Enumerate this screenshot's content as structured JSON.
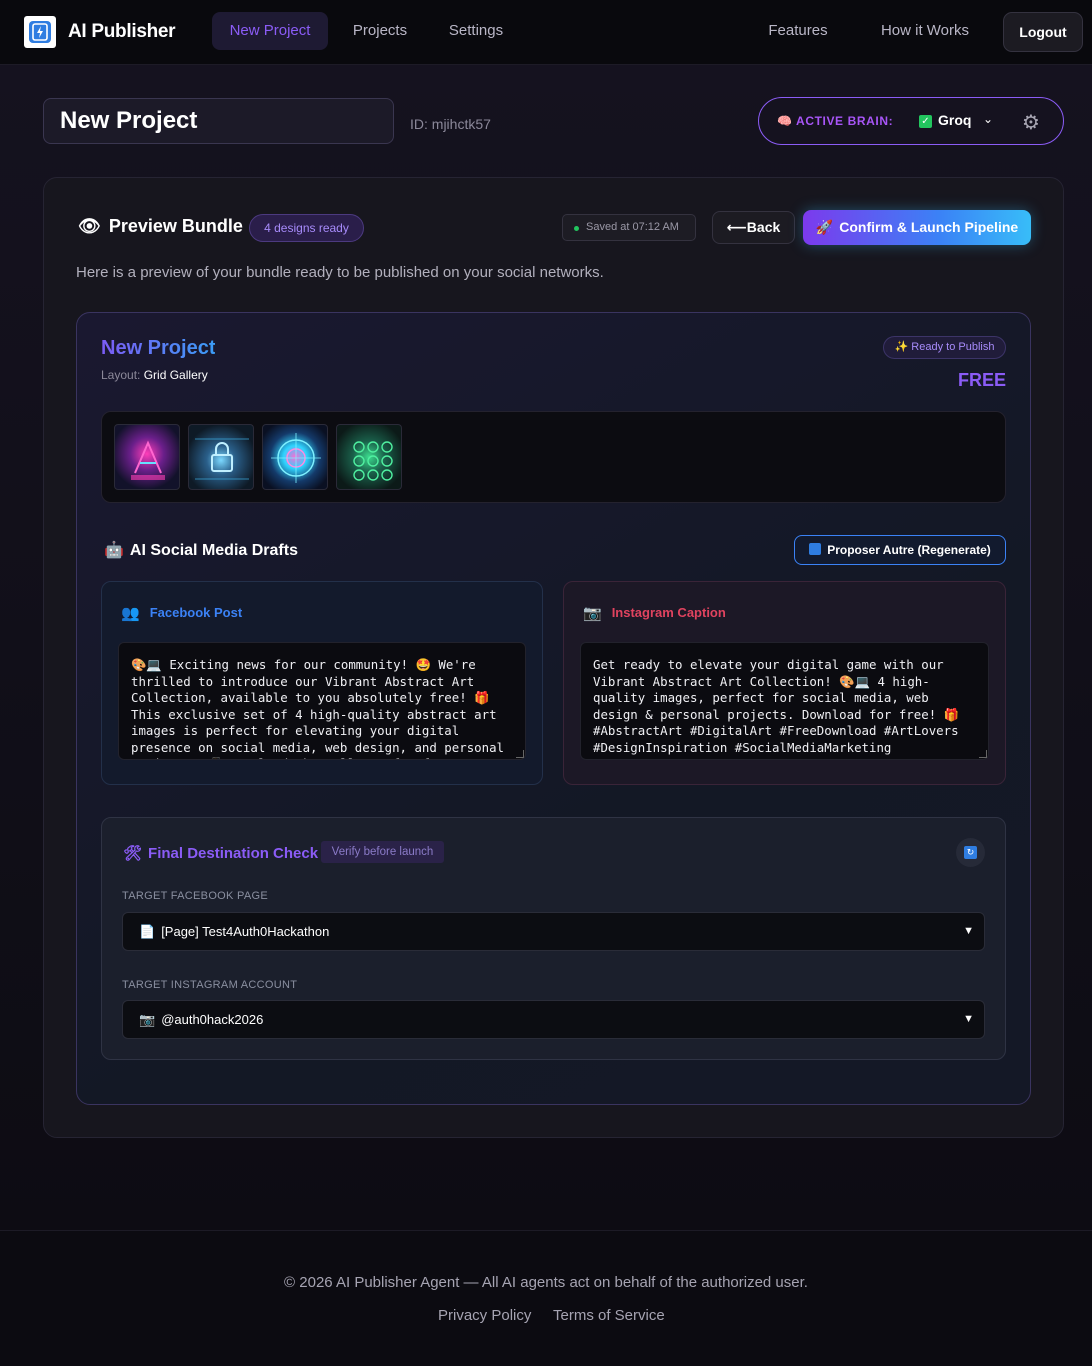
{
  "nav": {
    "brand": "AI Publisher",
    "links": [
      {
        "label": "New Project",
        "active": true
      },
      {
        "label": "Projects"
      },
      {
        "label": "Settings"
      }
    ],
    "right_links": [
      "Features",
      "How it Works"
    ],
    "logout_label": "Logout"
  },
  "project": {
    "title": "New Project",
    "id_text": "ID: mjihctk57"
  },
  "brain": {
    "label": "ACTIVE BRAIN:",
    "value": "Groq"
  },
  "preview": {
    "title": "Preview Bundle",
    "designs_badge": "4 designs ready",
    "saved_text": "Saved at 07:12 AM",
    "back_label": "Back",
    "launch_label": "Confirm & Launch Pipeline",
    "description": "Here is a preview of your bundle ready to be published on your social networks."
  },
  "bundle": {
    "title": "New Project",
    "layout_label": "Layout:",
    "layout_value": "Grid Gallery",
    "ready_badge": "Ready to Publish",
    "price": "FREE",
    "thumbnails": [
      "design-1",
      "design-2",
      "design-3",
      "design-4"
    ]
  },
  "drafts": {
    "title": "AI Social Media Drafts",
    "regenerate_label": "Proposer Autre (Regenerate)",
    "facebook": {
      "heading": "Facebook Post",
      "text": "🎨💻 Exciting news for our community! 🤩 We're thrilled to introduce our Vibrant Abstract Art Collection, available to you absolutely free! 🎁 This exclusive set of 4 high-quality abstract art images is perfect for elevating your digital presence on social media, web design, and personal projects. 📲 Download them all now for free!"
    },
    "instagram": {
      "heading": "Instagram Caption",
      "text": "Get ready to elevate your digital game with our Vibrant Abstract Art Collection! 🎨💻 4 high-quality images, perfect for social media, web design & personal projects. Download for free! 🎁 #AbstractArt #DigitalArt #FreeDownload #ArtLovers #DesignInspiration #SocialMediaMarketing"
    }
  },
  "destination": {
    "title": "Final Destination Check",
    "verify_badge": "Verify before launch",
    "facebook_label": "TARGET FACEBOOK PAGE",
    "facebook_value": "[Page] Test4Auth0Hackathon",
    "instagram_label": "TARGET INSTAGRAM ACCOUNT",
    "instagram_value": "@auth0hack2026"
  },
  "footer": {
    "copyright": "© 2026 AI Publisher Agent — All AI agents act on behalf of the authorized user.",
    "links": [
      "Privacy Policy",
      "Terms of Service"
    ]
  },
  "colors": {
    "accent": "#8b5cf6",
    "blue": "#3b82f6",
    "facebook_blue": "#3b82f6",
    "instagram_pink": "#e0435f",
    "success": "#22c55e"
  }
}
